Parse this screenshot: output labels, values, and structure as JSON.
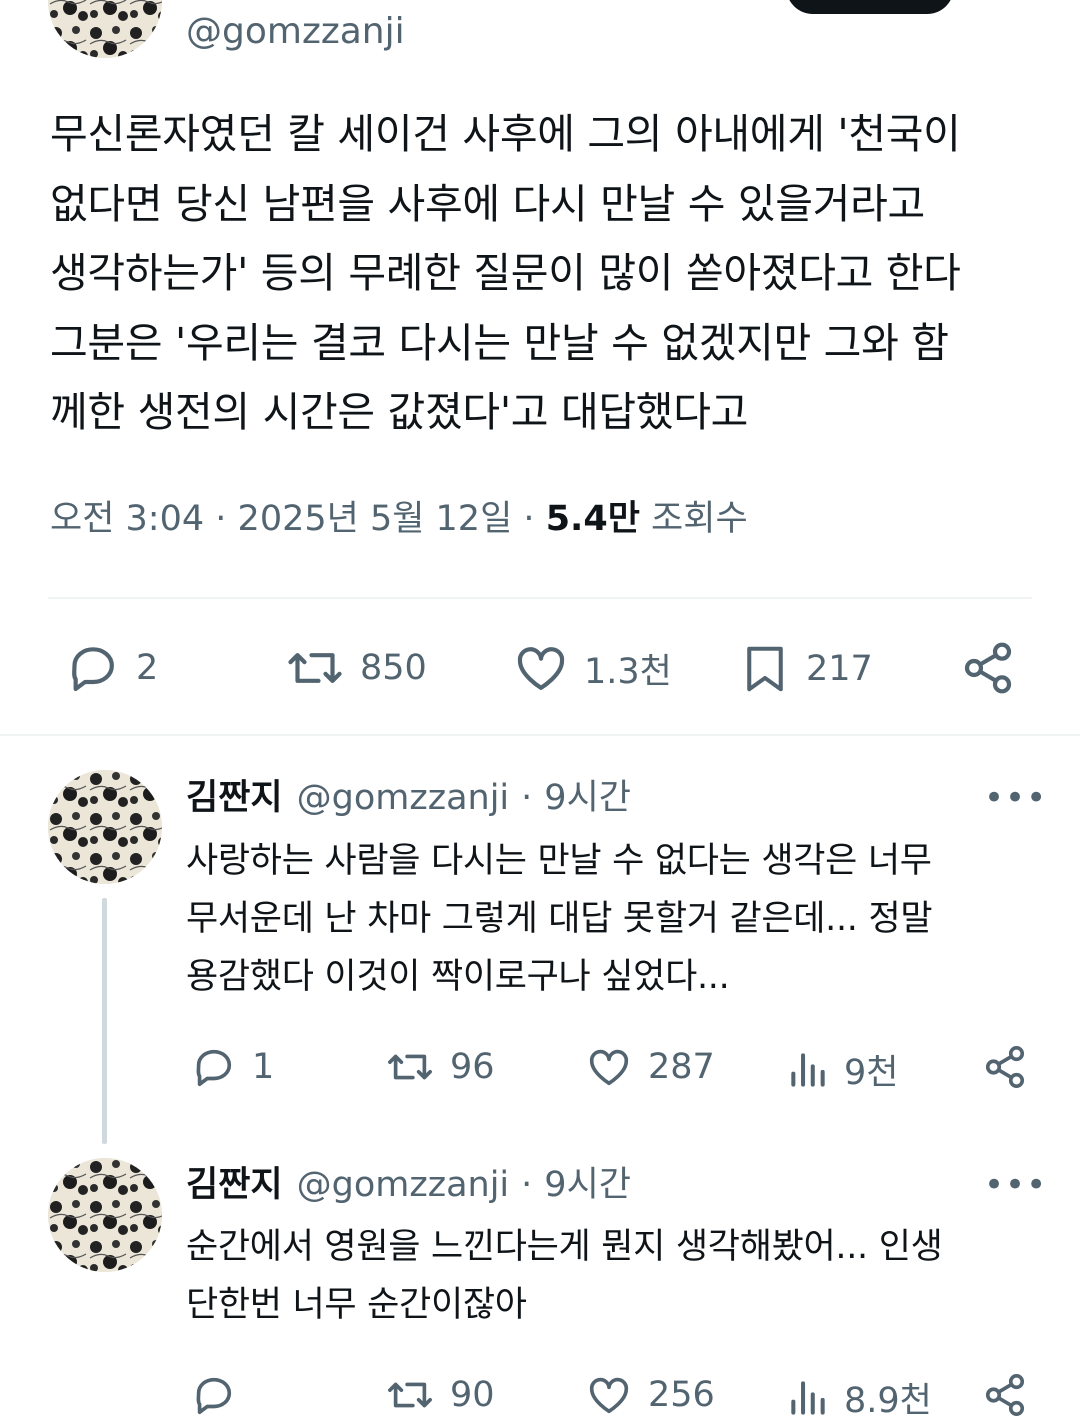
{
  "main_tweet": {
    "handle": "@gomzzanji",
    "text": "무신론자였던 칼 세이건 사후에 그의 아내에게 '천국이\n없다면 당신 남편을 사후에 다시 만날 수 있을거라고\n생각하는가' 등의 무례한 질문이 많이 쏟아졌다고 한다\n그분은 '우리는 결코 다시는 만날 수 없겠지만 그와 함\n께한 생전의 시간은 값졌다'고 대답했다고",
    "time": "오전 3:04",
    "date": "2025년 5월 12일",
    "views_count": "5.4만",
    "views_label": "조회수",
    "separator": "·",
    "stats": {
      "replies": "2",
      "retweets": "850",
      "likes": "1.3천",
      "bookmarks": "217"
    }
  },
  "replies": [
    {
      "name": "김짠지",
      "handle": "@gomzzanji",
      "separator": "·",
      "time": "9시간",
      "text": "사랑하는 사람을 다시는 만날 수 없다는 생각은 너무\n무서운데 난 차마 그렇게 대답 못할거 같은데... 정말\n용감했다 이것이 짝이로구나 싶었다...",
      "stats": {
        "replies": "1",
        "retweets": "96",
        "likes": "287",
        "views": "9천"
      }
    },
    {
      "name": "김짠지",
      "handle": "@gomzzanji",
      "separator": "·",
      "time": "9시간",
      "text": "순간에서 영원을 느낀다는게 뭔지 생각해봤어... 인생\n단한번 너무 순간이잖아",
      "stats": {
        "replies": "",
        "retweets": "90",
        "likes": "256",
        "views": "8.9천"
      }
    }
  ],
  "icons": [
    "reply-icon",
    "retweet-icon",
    "like-icon",
    "bookmark-icon",
    "share-icon",
    "views-icon",
    "more-icon",
    "avatar"
  ],
  "colors": {
    "text": "#0f1419",
    "secondary": "#536471",
    "divider": "#eff3f4",
    "thread_line": "#cfd9de"
  }
}
